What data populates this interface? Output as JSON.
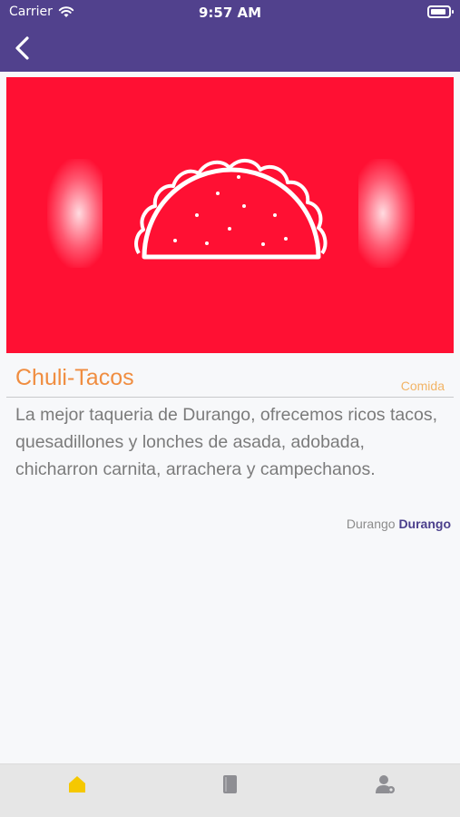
{
  "status_bar": {
    "carrier": "Carrier",
    "time": "9:57 AM"
  },
  "header": {
    "back_icon": "chevron-left-icon",
    "background": "#51418d"
  },
  "hero": {
    "image_icon": "taco-icon",
    "background": "#ff1033"
  },
  "business": {
    "name": "Chuli-Tacos",
    "category": "Comida",
    "description": "La mejor taqueria de Durango, ofrecemos ricos tacos, quesadillones y lonches de asada, adobada, chicharron carnita, arrachera y campechanos.",
    "city": "Durango",
    "state": "Durango"
  },
  "tabbar": {
    "items": [
      {
        "icon": "home-icon",
        "active": true,
        "color": "#f5c800"
      },
      {
        "icon": "book-icon",
        "active": false,
        "color": "#8e8e93"
      },
      {
        "icon": "user-settings-icon",
        "active": false,
        "color": "#8e8e93"
      }
    ]
  }
}
